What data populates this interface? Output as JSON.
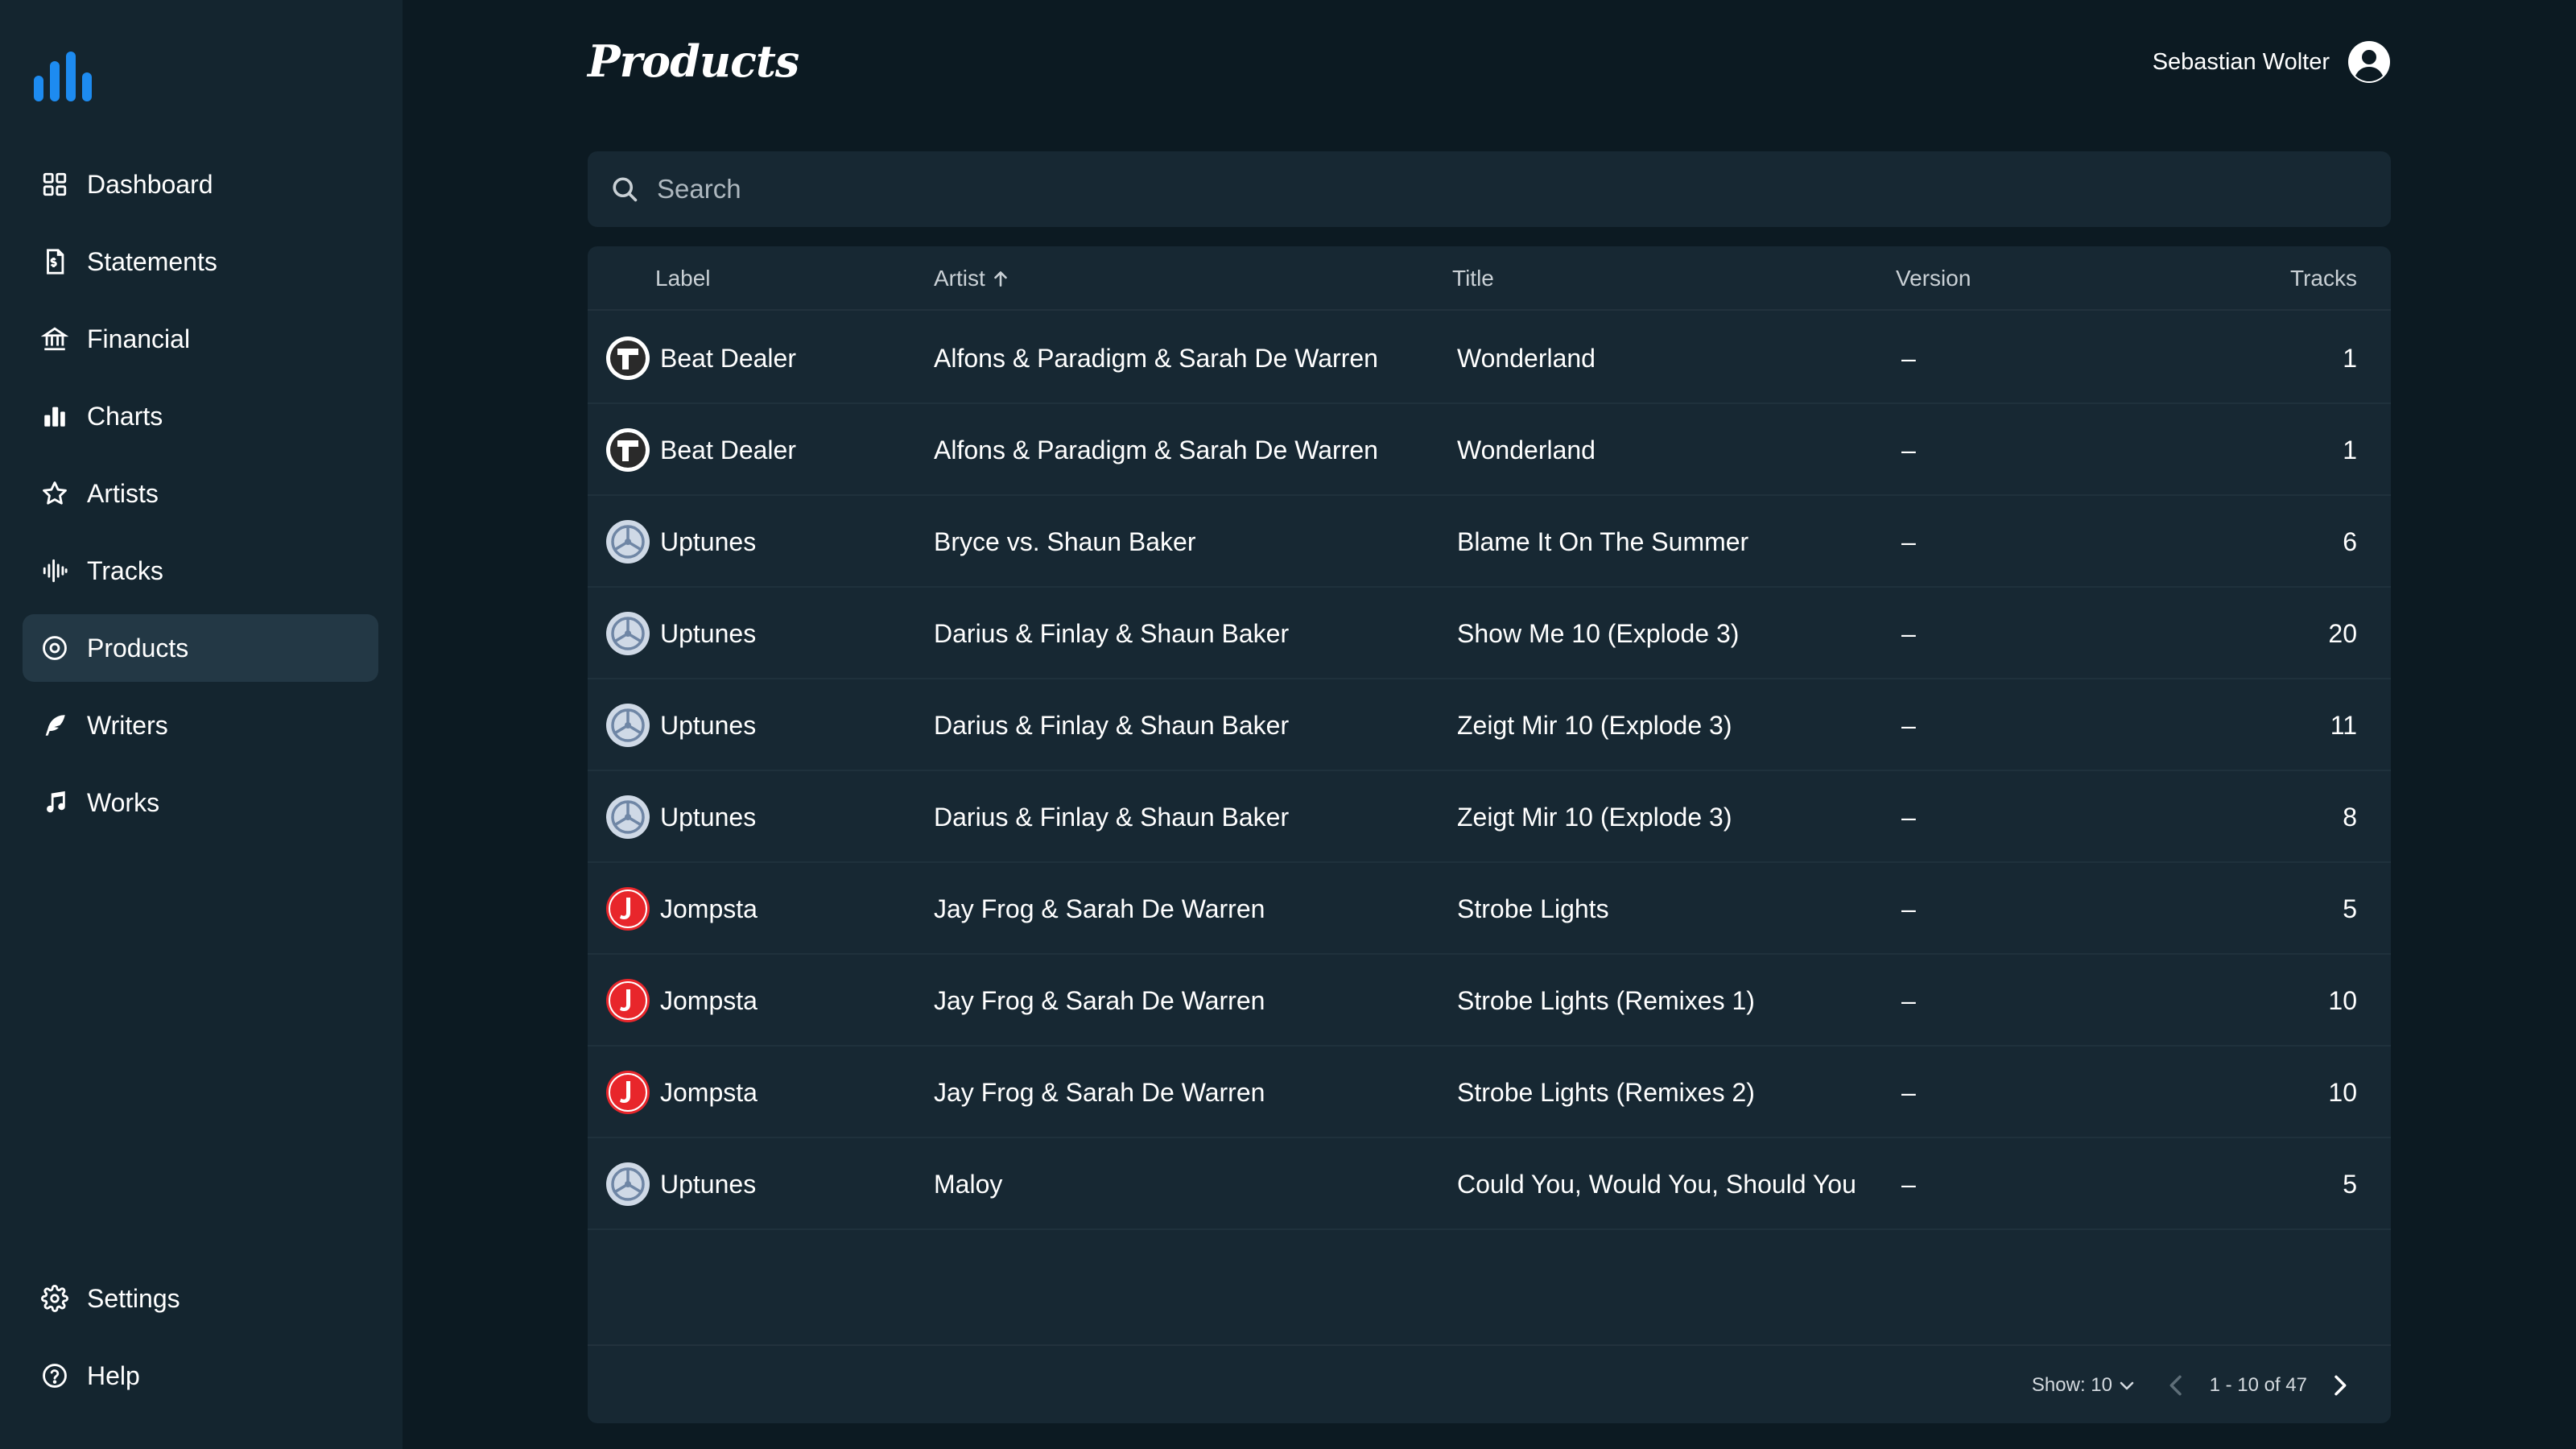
{
  "sidebar": {
    "items": [
      {
        "label": "Dashboard",
        "icon": "grid-icon"
      },
      {
        "label": "Statements",
        "icon": "statement-icon"
      },
      {
        "label": "Financial",
        "icon": "bank-icon"
      },
      {
        "label": "Charts",
        "icon": "bar-chart-icon"
      },
      {
        "label": "Artists",
        "icon": "star-icon"
      },
      {
        "label": "Tracks",
        "icon": "waveform-icon"
      },
      {
        "label": "Products",
        "icon": "disc-icon",
        "active": true
      },
      {
        "label": "Writers",
        "icon": "feather-icon"
      },
      {
        "label": "Works",
        "icon": "music-note-icon"
      }
    ],
    "bottom_items": [
      {
        "label": "Settings",
        "icon": "gear-icon"
      },
      {
        "label": "Help",
        "icon": "help-icon"
      }
    ]
  },
  "header": {
    "title": "Products",
    "user_name": "Sebastian Wolter"
  },
  "search": {
    "placeholder": "Search"
  },
  "table": {
    "columns": {
      "label": "Label",
      "artist": "Artist",
      "title": "Title",
      "version": "Version",
      "tracks": "Tracks"
    },
    "sort_column": "artist",
    "rows": [
      {
        "label": "Beat Dealer",
        "label_logo": "beat-dealer",
        "artist": "Alfons & Paradigm & Sarah De Warren",
        "title": "Wonderland",
        "version": "–",
        "tracks": "1"
      },
      {
        "label": "Beat Dealer",
        "label_logo": "beat-dealer",
        "artist": "Alfons & Paradigm & Sarah De Warren",
        "title": "Wonderland",
        "version": "–",
        "tracks": "1"
      },
      {
        "label": "Uptunes",
        "label_logo": "uptunes",
        "artist": "Bryce vs. Shaun Baker",
        "title": "Blame It On The Summer",
        "version": "–",
        "tracks": "6"
      },
      {
        "label": "Uptunes",
        "label_logo": "uptunes",
        "artist": "Darius & Finlay & Shaun Baker",
        "title": "Show Me 10 (Explode 3)",
        "version": "–",
        "tracks": "20"
      },
      {
        "label": "Uptunes",
        "label_logo": "uptunes",
        "artist": "Darius & Finlay & Shaun Baker",
        "title": "Zeigt Mir 10 (Explode 3)",
        "version": "–",
        "tracks": "11"
      },
      {
        "label": "Uptunes",
        "label_logo": "uptunes",
        "artist": "Darius & Finlay & Shaun Baker",
        "title": "Zeigt Mir 10 (Explode 3)",
        "version": "–",
        "tracks": "8"
      },
      {
        "label": "Jompsta",
        "label_logo": "jompsta",
        "artist": "Jay Frog & Sarah De Warren",
        "title": "Strobe Lights",
        "version": "–",
        "tracks": "5"
      },
      {
        "label": "Jompsta",
        "label_logo": "jompsta",
        "artist": "Jay Frog & Sarah De Warren",
        "title": "Strobe Lights (Remixes 1)",
        "version": "–",
        "tracks": "10"
      },
      {
        "label": "Jompsta",
        "label_logo": "jompsta",
        "artist": "Jay Frog & Sarah De Warren",
        "title": "Strobe Lights (Remixes 2)",
        "version": "–",
        "tracks": "10"
      },
      {
        "label": "Uptunes",
        "label_logo": "uptunes",
        "artist": "Maloy",
        "title": "Could You, Would You, Should You",
        "version": "–",
        "tracks": "5"
      }
    ]
  },
  "footer": {
    "show_label": "Show: 10",
    "range": "1 - 10 of 47"
  },
  "colors": {
    "background": "#0c1a22",
    "sidebar": "#14252f",
    "card": "#172833",
    "active_nav": "#233845",
    "accent": "#1d8bf0",
    "jompsta_red": "#e8262b"
  }
}
